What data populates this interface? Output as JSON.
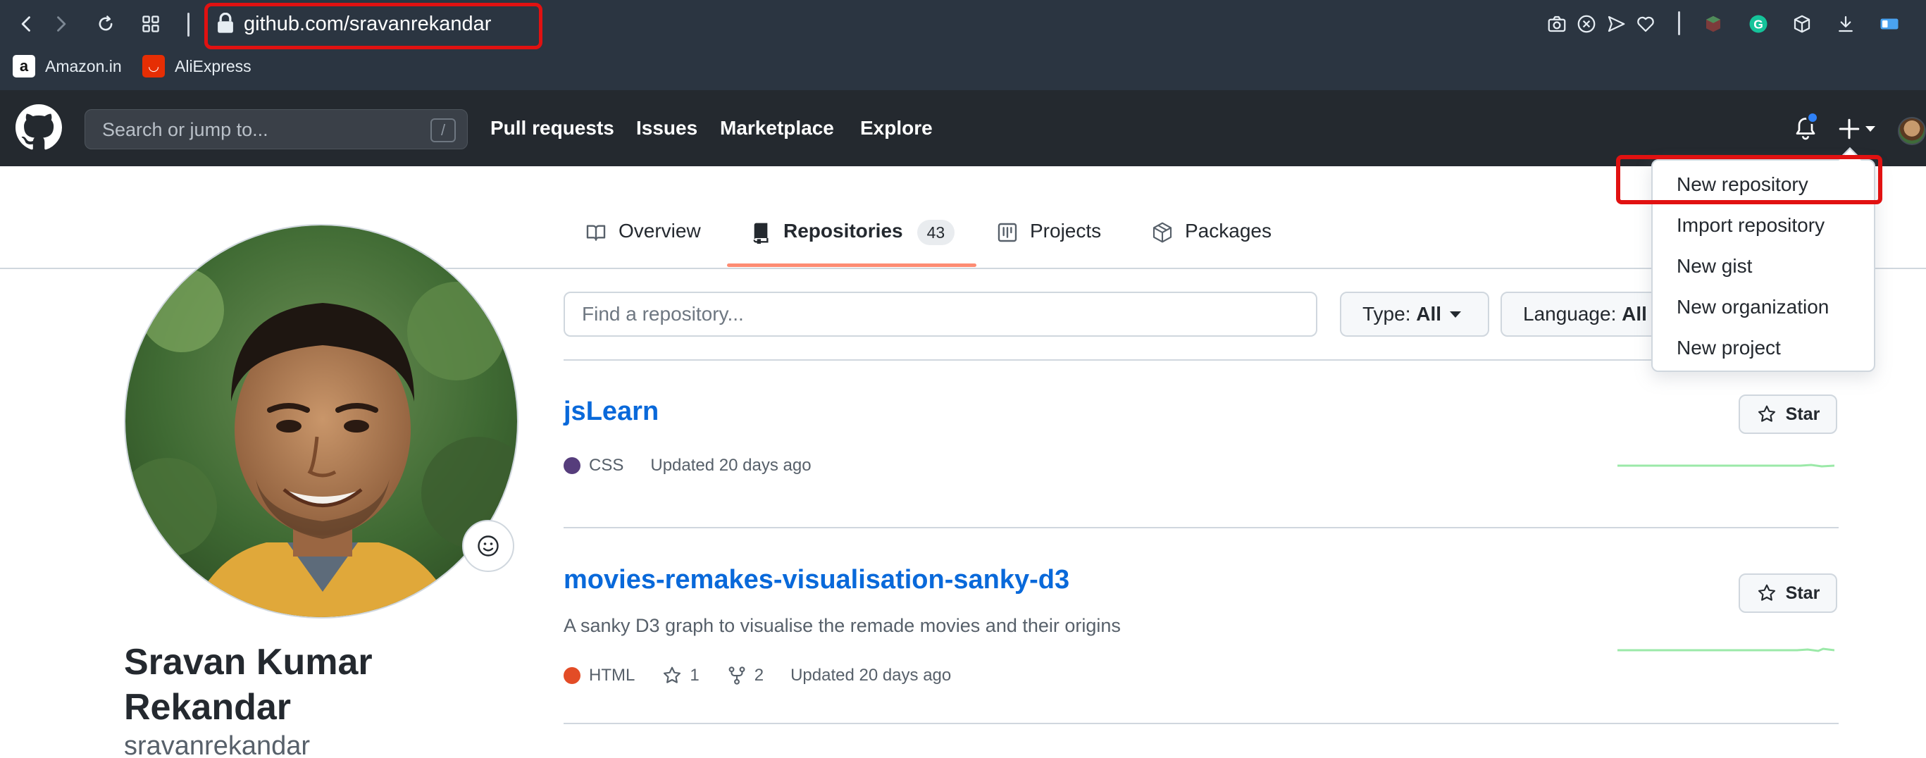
{
  "browser": {
    "url": "github.com/sravanrekandar",
    "bookmarks": [
      {
        "label": "Amazon.in",
        "icon": "amazon-icon"
      },
      {
        "label": "AliExpress",
        "icon": "aliexpress-icon"
      }
    ]
  },
  "header": {
    "search_placeholder": "Search or jump to...",
    "search_shortcut": "/",
    "nav": [
      "Pull requests",
      "Issues",
      "Marketplace",
      "Explore"
    ]
  },
  "tabs": [
    {
      "label": "Overview",
      "icon": "book-icon"
    },
    {
      "label": "Repositories",
      "icon": "repo-icon",
      "count": "43",
      "active": true
    },
    {
      "label": "Projects",
      "icon": "project-icon"
    },
    {
      "label": "Packages",
      "icon": "package-icon"
    }
  ],
  "profile": {
    "name": "Sravan Kumar Rekandar",
    "login": "sravanrekandar"
  },
  "filters": {
    "find_placeholder": "Find a repository...",
    "type_label": "Type:",
    "type_value": "All",
    "language_label": "Language:",
    "language_value": "All"
  },
  "repos": [
    {
      "name": "jsLearn",
      "description": "",
      "language": "CSS",
      "language_color": "#563d7c",
      "stars": "",
      "forks": "",
      "updated": "Updated 20 days ago",
      "star_label": "Star"
    },
    {
      "name": "movies-remakes-visualisation-sanky-d3",
      "description": "A sanky D3 graph to visualise the remade movies and their origins",
      "language": "HTML",
      "language_color": "#e34c26",
      "stars": "1",
      "forks": "2",
      "updated": "Updated 20 days ago",
      "star_label": "Star"
    }
  ],
  "dropdown": {
    "items": [
      "New repository",
      "Import repository",
      "New gist",
      "New organization",
      "New project"
    ],
    "highlighted": "New repository"
  },
  "colors": {
    "annotation": "#e11111",
    "link": "#0969da",
    "tab_underline": "#fd8c73",
    "header_bg": "#24292f"
  }
}
